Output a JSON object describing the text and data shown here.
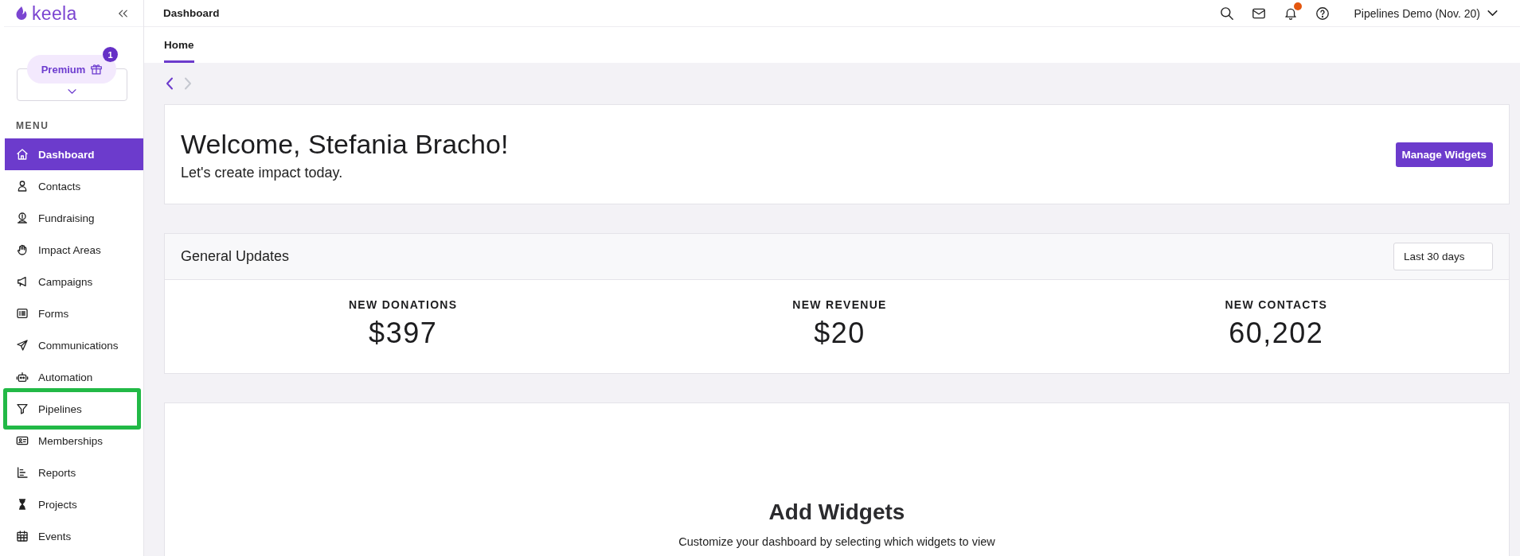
{
  "logo": {
    "text": "keela"
  },
  "sidebar": {
    "premium": {
      "label": "Premium",
      "badge": "1"
    },
    "menu_heading": "MENU",
    "items": [
      {
        "label": "Dashboard",
        "selected": true,
        "highlighted": false
      },
      {
        "label": "Contacts",
        "selected": false,
        "highlighted": false
      },
      {
        "label": "Fundraising",
        "selected": false,
        "highlighted": false
      },
      {
        "label": "Impact Areas",
        "selected": false,
        "highlighted": false
      },
      {
        "label": "Campaigns",
        "selected": false,
        "highlighted": false
      },
      {
        "label": "Forms",
        "selected": false,
        "highlighted": false
      },
      {
        "label": "Communications",
        "selected": false,
        "highlighted": false
      },
      {
        "label": "Automation",
        "selected": false,
        "highlighted": false
      },
      {
        "label": "Pipelines",
        "selected": false,
        "highlighted": true
      },
      {
        "label": "Memberships",
        "selected": false,
        "highlighted": false
      },
      {
        "label": "Reports",
        "selected": false,
        "highlighted": false
      },
      {
        "label": "Projects",
        "selected": false,
        "highlighted": false
      },
      {
        "label": "Events",
        "selected": false,
        "highlighted": false
      }
    ]
  },
  "header": {
    "title": "Dashboard",
    "unread_notifications": true,
    "account": "Pipelines Demo (Nov. 20)"
  },
  "tabs": [
    {
      "label": "Home",
      "selected": true
    }
  ],
  "pager": [
    {
      "disabled": false
    },
    {
      "disabled": true
    }
  ],
  "welcome": {
    "title": "Welcome, Stefania Bracho!",
    "subtitle": "Let's create impact today.",
    "button": "Manage Widgets"
  },
  "general_updates": {
    "title": "General Updates",
    "period": "Last 30 days",
    "stats": [
      {
        "label": "NEW DONATIONS",
        "value": "$397"
      },
      {
        "label": "NEW REVENUE",
        "value": "$20"
      },
      {
        "label": "NEW CONTACTS",
        "value": "60,202"
      }
    ]
  },
  "add_widgets": {
    "title": "Add Widgets",
    "text": "Customize your dashboard by selecting which widgets to view"
  }
}
